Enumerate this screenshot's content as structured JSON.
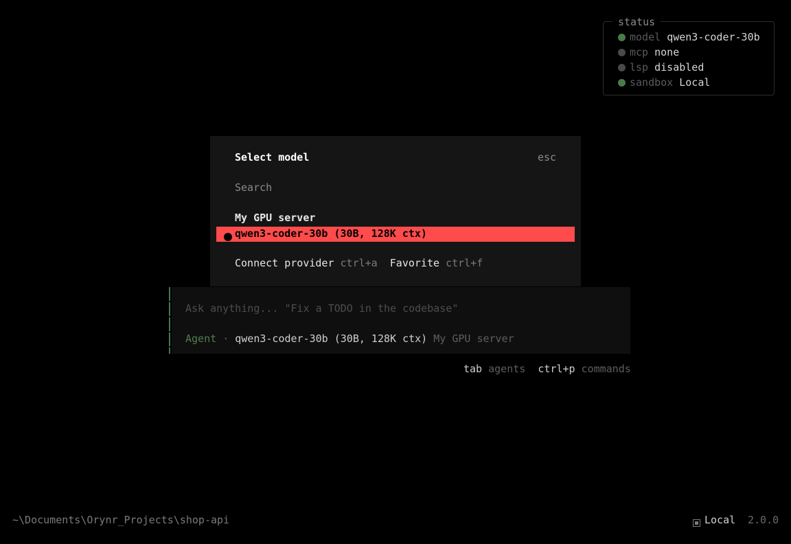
{
  "status": {
    "title": "status",
    "rows": [
      {
        "key": "model",
        "value": "qwen3-coder-30b",
        "color": "#4a7a4a"
      },
      {
        "key": "mcp",
        "value": "none",
        "color": "#4a4a4a"
      },
      {
        "key": "lsp",
        "value": "disabled",
        "color": "#4a4a4a"
      },
      {
        "key": "sandbox",
        "value": "Local",
        "color": "#4a7a4a"
      }
    ]
  },
  "dialog": {
    "title": "Select model",
    "close_hint": "esc",
    "search_placeholder": "Search",
    "group_label": "My GPU server",
    "selected_model": "qwen3-coder-30b (30B, 128K ctx)",
    "accent": "#ff4b4b",
    "actions": [
      {
        "label": "Connect provider",
        "shortcut": "ctrl+a"
      },
      {
        "label": "Favorite",
        "shortcut": "ctrl+f"
      }
    ]
  },
  "prompt": {
    "placeholder": "Ask anything... \"Fix a TODO in the codebase\"",
    "agent": "Agent",
    "separator": "·",
    "model": "qwen3-coder-30b (30B, 128K ctx)",
    "provider": "My GPU server"
  },
  "hints": [
    {
      "key": "tab",
      "desc": "agents"
    },
    {
      "key": "ctrl+p",
      "desc": "commands"
    }
  ],
  "footer": {
    "path": "~\\Documents\\Orynr_Projects\\shop-api",
    "sandbox_label": "Local",
    "version": "2.0.0",
    "sandbox_icon": "sandbox-icon"
  }
}
